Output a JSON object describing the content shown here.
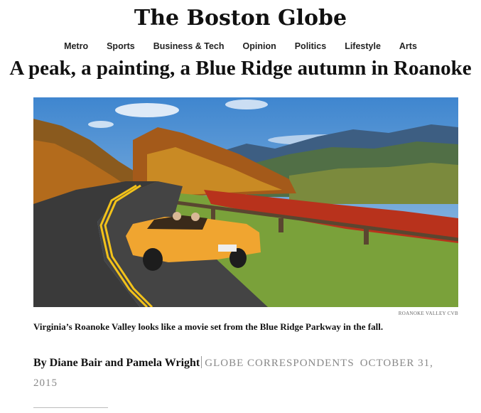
{
  "masthead": {
    "title": "The Boston Globe"
  },
  "nav": {
    "items": [
      "Metro",
      "Sports",
      "Business & Tech",
      "Opinion",
      "Politics",
      "Lifestyle",
      "Arts"
    ]
  },
  "article": {
    "headline": "A peak, a painting, a Blue Ridge autumn in Roanoke",
    "photo_credit": "ROANOKE VALLEY CVB",
    "caption": "Virginia’s Roanoke Valley looks like a movie set from the Blue Ridge Parkway in the fall.",
    "byline": {
      "authors": "By Diane Bair and Pamela Wright",
      "role": "GLOBE CORRESPONDENTS",
      "date": "OCTOBER 31, 2015"
    }
  },
  "colors": {
    "sky": "#5f9bd4",
    "car": "#f0a530",
    "road": "#3a3a3a",
    "road_line": "#f2c21a"
  }
}
